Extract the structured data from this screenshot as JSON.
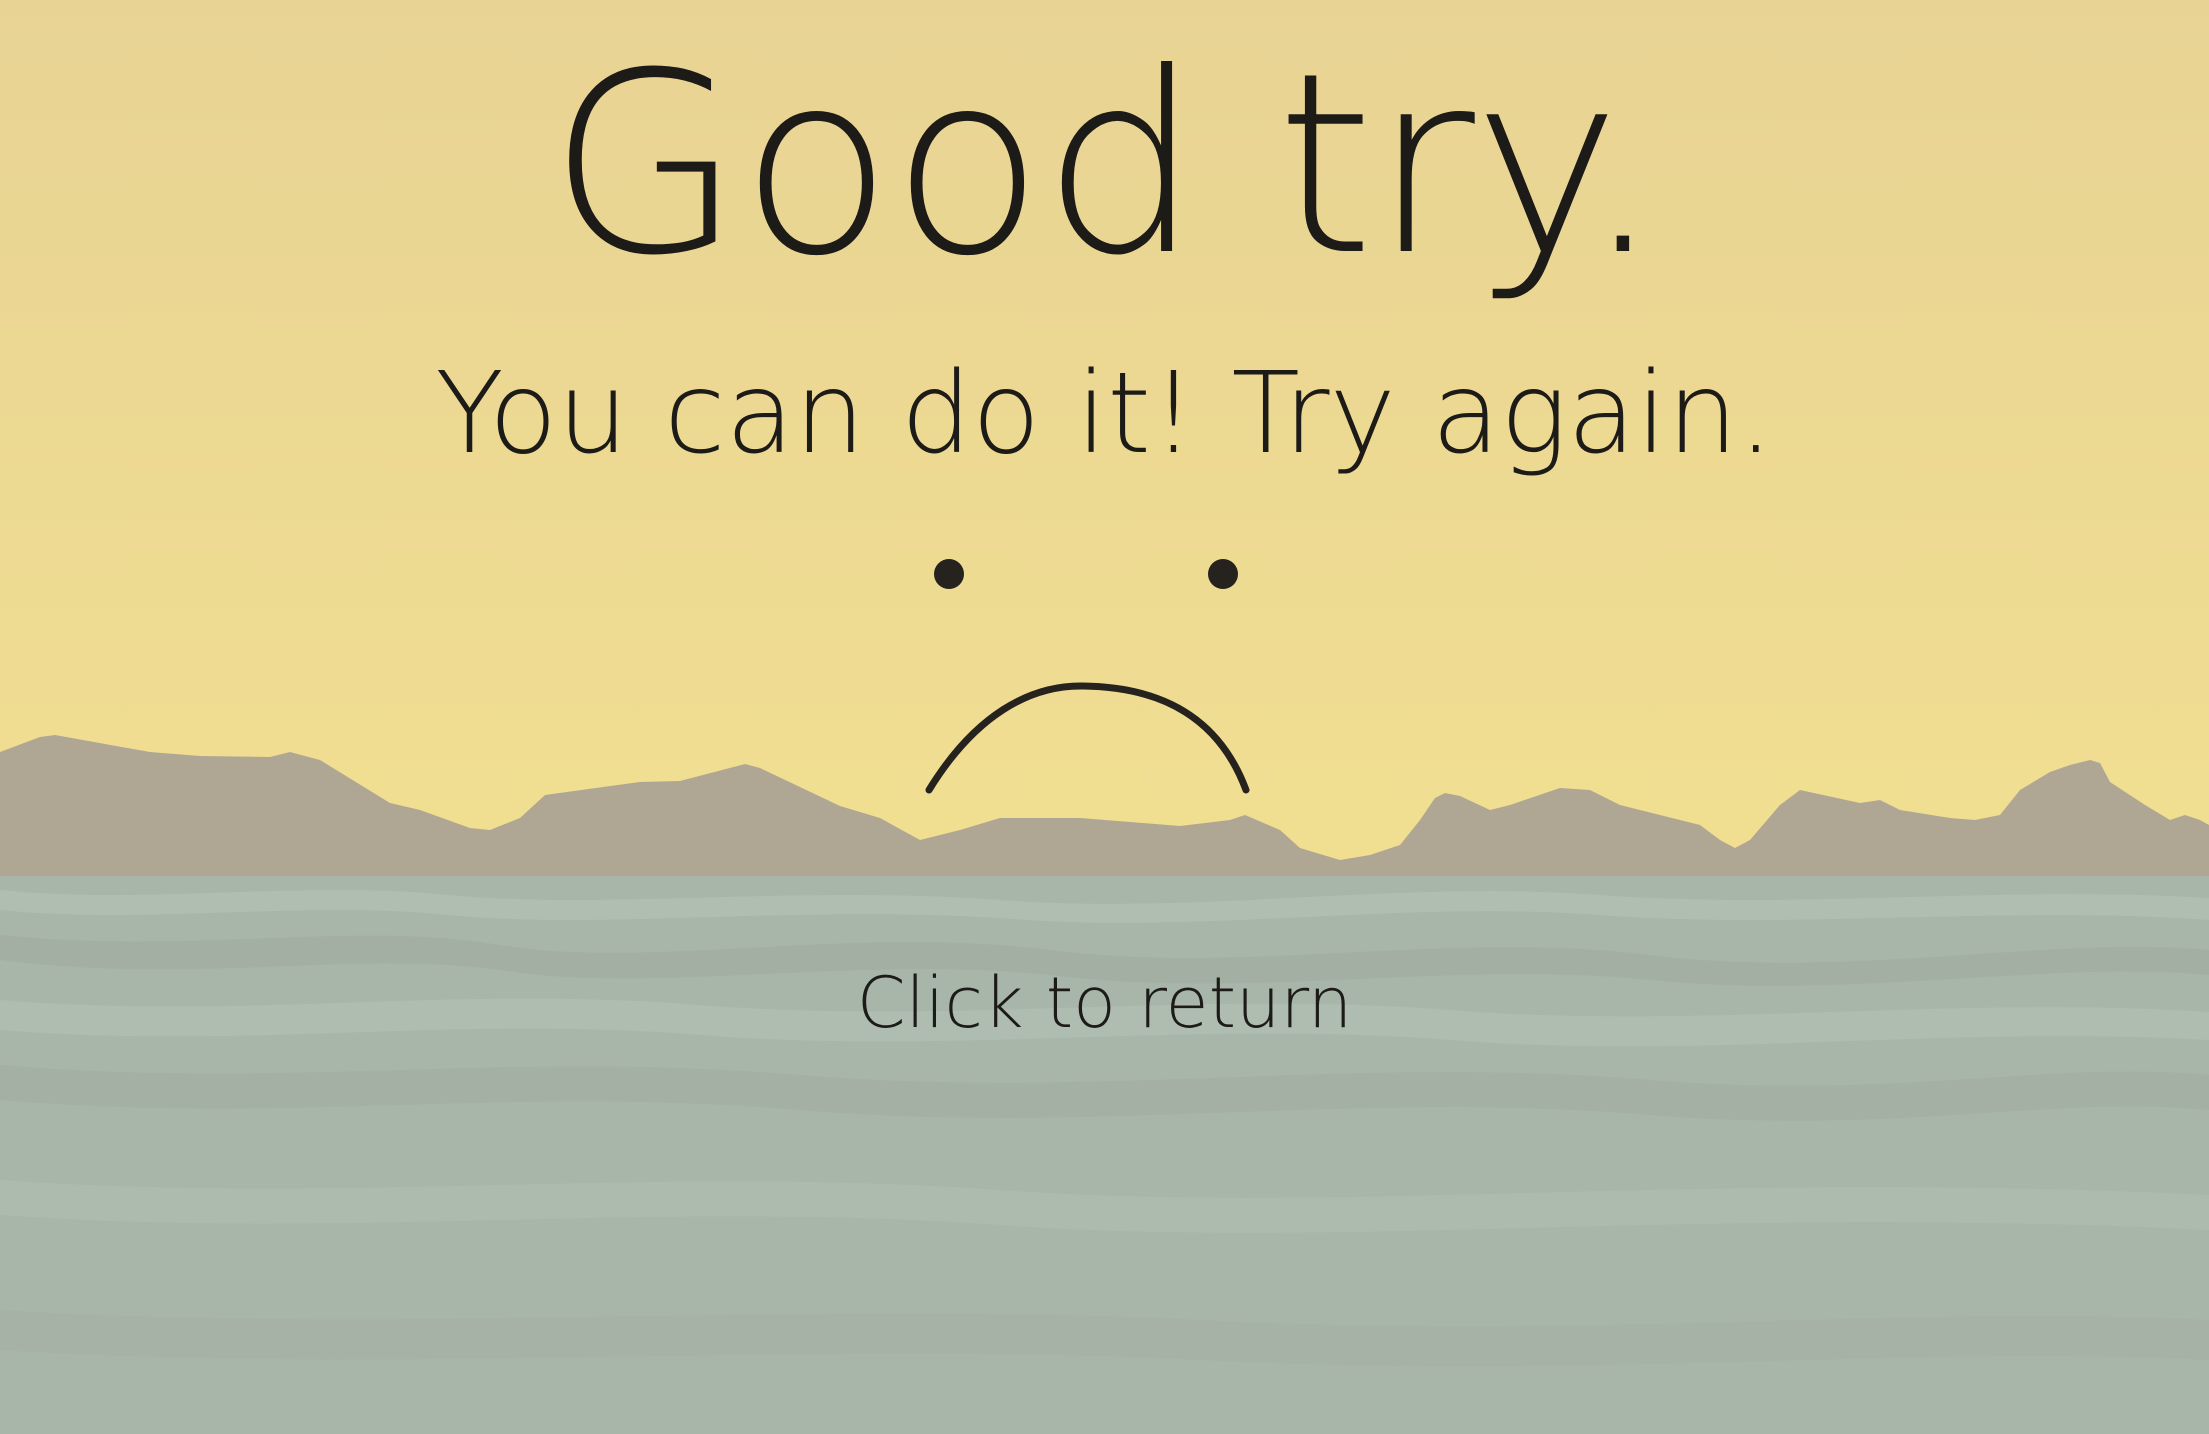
{
  "screen": {
    "title": "Good try.",
    "subtitle": "You can do it! Try again.",
    "return_label": "Click to return"
  },
  "face": {
    "expression": "frown",
    "color": "#26221e"
  },
  "colors": {
    "sky_top": "#e8d394",
    "sky_bottom": "#f0df93",
    "mountains": "#afa794",
    "sea": "#a7b5a8",
    "sea_dark": "#9daa9f",
    "sea_light": "#b1bfb3"
  }
}
